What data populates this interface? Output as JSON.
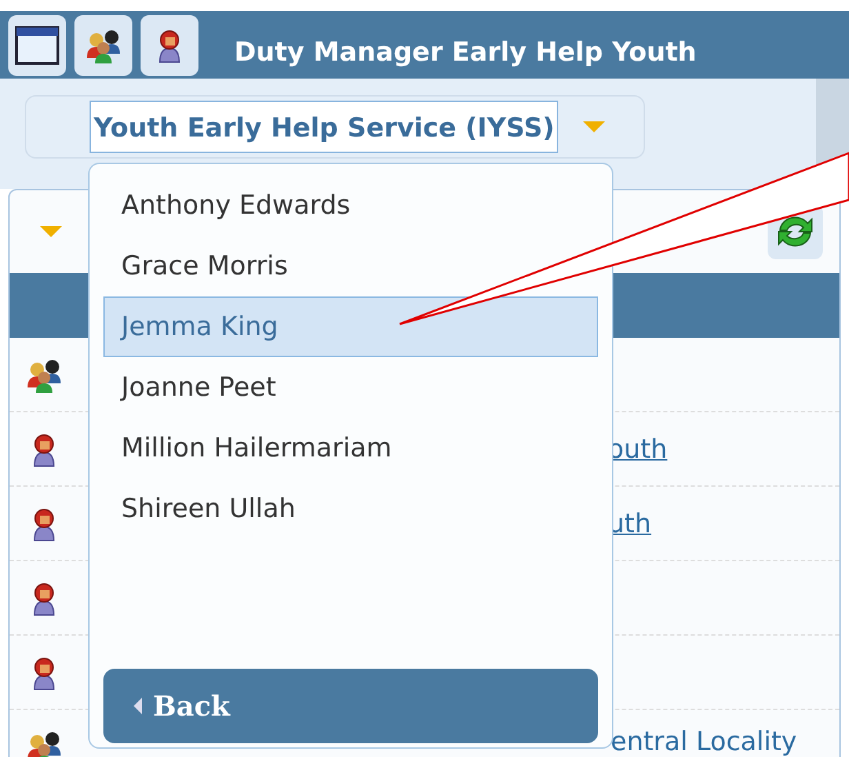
{
  "window": {
    "title": "Duty Manager Early Help Youth"
  },
  "service_select": {
    "value": "Youth Early Help Service (IYSS)"
  },
  "rows": [
    {
      "kind": "group"
    },
    {
      "kind": "person",
      "link": "outh"
    },
    {
      "kind": "person",
      "link": "uth"
    },
    {
      "kind": "person"
    },
    {
      "kind": "person"
    },
    {
      "kind": "group",
      "link": "entral Locality"
    }
  ],
  "dropdown": {
    "items": [
      {
        "label": "Anthony Edwards",
        "selected": false
      },
      {
        "label": "Grace Morris",
        "selected": false
      },
      {
        "label": "Jemma King",
        "selected": true
      },
      {
        "label": "Joanne Peet",
        "selected": false
      },
      {
        "label": "Million Hailermariam",
        "selected": false
      },
      {
        "label": "Shireen Ullah",
        "selected": false
      }
    ],
    "back_button": "Back"
  }
}
